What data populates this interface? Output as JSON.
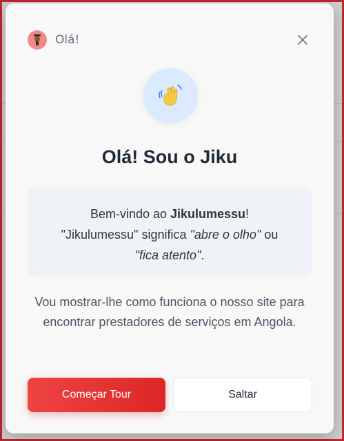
{
  "modal": {
    "header_title": "Olá!",
    "close_glyph": "×",
    "wave_emoji": "👋",
    "title": "Olá! Sou o Jiku",
    "intro": {
      "line1_prefix": "Bem-vindo ao ",
      "line1_bold": "Jikulumessu",
      "line1_suffix": "!",
      "line2_prefix": "\"Jikulumessu\" significa ",
      "line2_italic": "\"abre o olho\"",
      "line2_suffix": " ou",
      "line3_italic": "\"fica atento\"",
      "line3_suffix": "."
    },
    "description": "Vou mostrar-lhe como funciona o nosso site para encontrar prestadores de serviços em Angola.",
    "start_tour_label": "Começar Tour",
    "skip_label": "Saltar"
  },
  "colors": {
    "primary": "#dc2626",
    "wave_bg": "#dbeafe",
    "avatar_bg": "#f08a8a"
  }
}
